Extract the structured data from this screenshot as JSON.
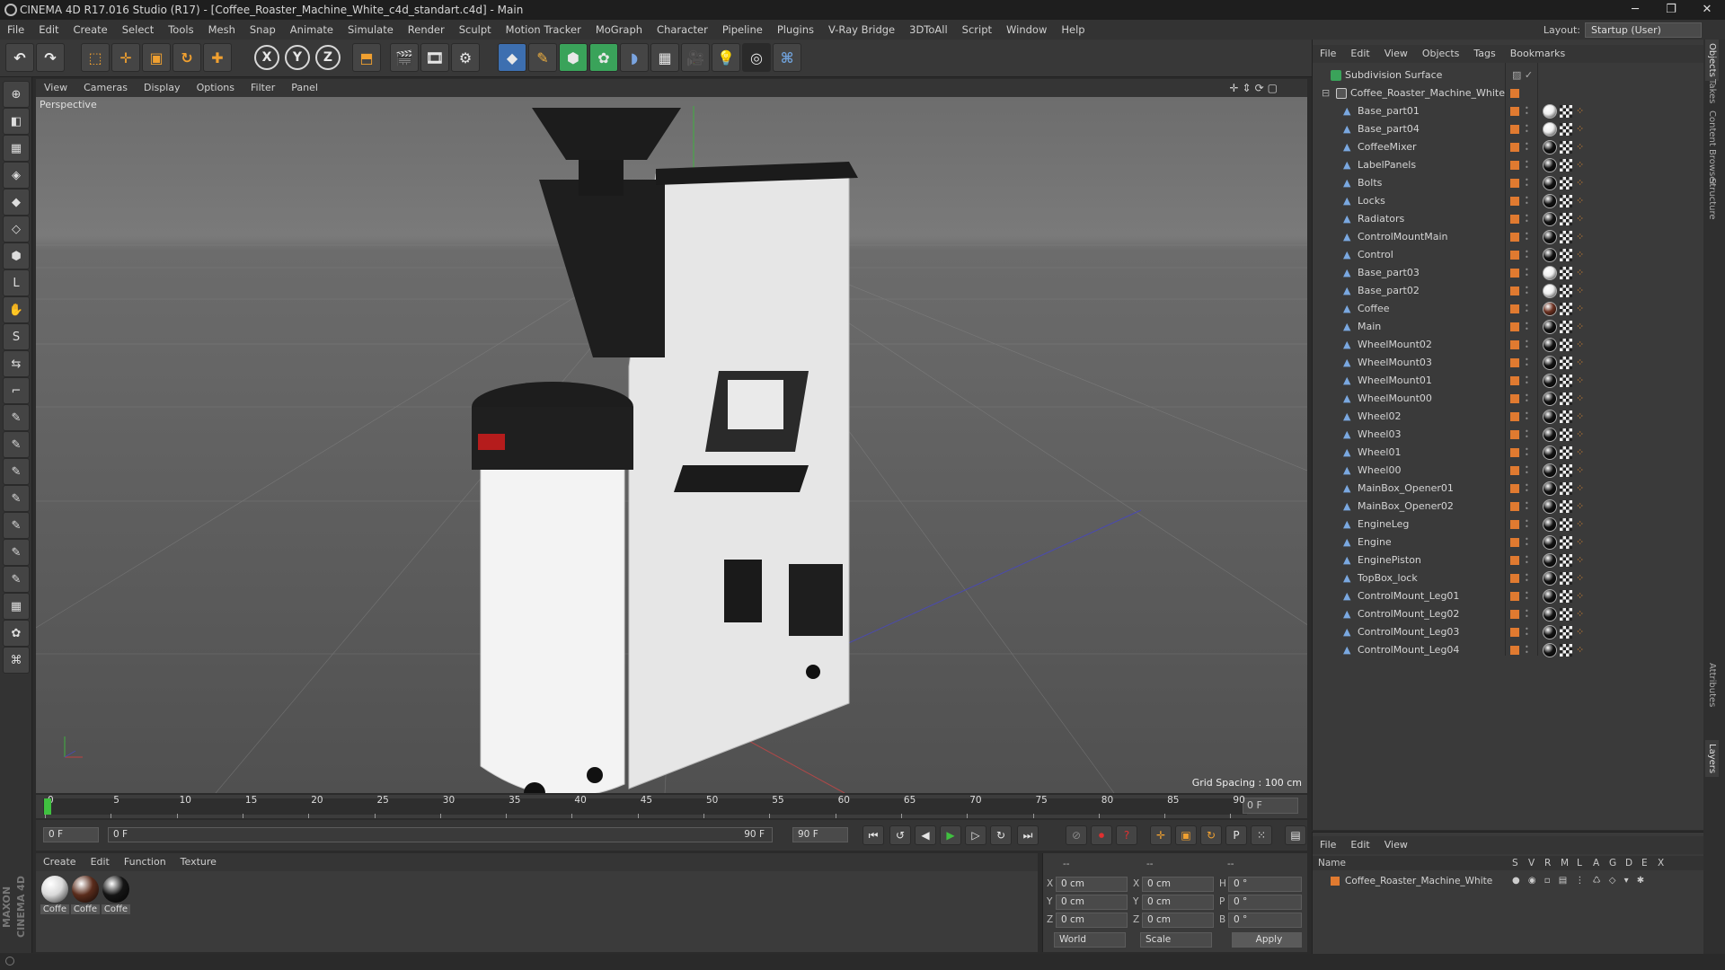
{
  "window": {
    "title": "CINEMA 4D R17.016 Studio (R17) - [Coffee_Roaster_Machine_White_c4d_standart.c4d] - Main"
  },
  "menu": [
    "File",
    "Edit",
    "Create",
    "Select",
    "Tools",
    "Mesh",
    "Snap",
    "Animate",
    "Simulate",
    "Render",
    "Sculpt",
    "Motion Tracker",
    "MoGraph",
    "Character",
    "Pipeline",
    "Plugins",
    "V-Ray Bridge",
    "3DToAll",
    "Script",
    "Window",
    "Help"
  ],
  "layout": {
    "label": "Layout:",
    "value": "Startup (User)"
  },
  "toolbar": {
    "x_label": "X",
    "y_label": "Y",
    "z_label": "Z"
  },
  "viewport": {
    "menu": [
      "View",
      "Cameras",
      "Display",
      "Options",
      "Filter",
      "Panel"
    ],
    "label": "Perspective",
    "grid_spacing": "Grid Spacing : 100 cm"
  },
  "timeline": {
    "ticks": [
      "0",
      "5",
      "10",
      "15",
      "20",
      "25",
      "30",
      "35",
      "40",
      "45",
      "50",
      "55",
      "60",
      "65",
      "70",
      "75",
      "80",
      "85",
      "90"
    ],
    "frame_end": "0 F"
  },
  "transport": {
    "start": "0 F",
    "range_start": "0 F",
    "range_end": "90 F",
    "end": "90 F"
  },
  "materials": {
    "menu": [
      "Create",
      "Edit",
      "Function",
      "Texture"
    ],
    "items": [
      {
        "name": "Coffe",
        "color": "#d9d9d9"
      },
      {
        "name": "Coffe",
        "color": "#5a2c1c"
      },
      {
        "name": "Coffe",
        "color": "#151515"
      }
    ]
  },
  "coords": {
    "header_left": "--",
    "header_mid": "--",
    "header_right": "--",
    "rows": [
      {
        "a": "X",
        "av": "0 cm",
        "b": "X",
        "bv": "0 cm",
        "c": "H",
        "cv": "0 °"
      },
      {
        "a": "Y",
        "av": "0 cm",
        "b": "Y",
        "bv": "0 cm",
        "c": "P",
        "cv": "0 °"
      },
      {
        "a": "Z",
        "av": "0 cm",
        "b": "Z",
        "bv": "0 cm",
        "c": "B",
        "cv": "0 °"
      }
    ],
    "mode1": "World",
    "mode2": "Scale",
    "apply": "Apply"
  },
  "objects": {
    "menu": [
      "File",
      "Edit",
      "View",
      "Objects",
      "Tags",
      "Bookmarks"
    ],
    "root": "Subdivision Surface",
    "group": "Coffee_Roaster_Machine_White",
    "items": [
      "Base_part01",
      "Base_part04",
      "CoffeeMixer",
      "LabelPanels",
      "Bolts",
      "Locks",
      "Radiators",
      "ControlMountMain",
      "Control",
      "Base_part03",
      "Base_part02",
      "Coffee",
      "Main",
      "WheelMount02",
      "WheelMount03",
      "WheelMount01",
      "WheelMount00",
      "Wheel02",
      "Wheel03",
      "Wheel01",
      "Wheel00",
      "MainBox_Opener01",
      "MainBox_Opener02",
      "EngineLeg",
      "Engine",
      "EnginePiston",
      "TopBox_lock",
      "ControlMount_Leg01",
      "ControlMount_Leg02",
      "ControlMount_Leg03",
      "ControlMount_Leg04"
    ]
  },
  "attributes": {
    "menu": [
      "File",
      "Edit",
      "View"
    ],
    "col_name": "Name",
    "cols": [
      "S",
      "V",
      "R",
      "M",
      "L",
      "A",
      "G",
      "D",
      "E",
      "X"
    ],
    "row": "Coffee_Roaster_Machine_White"
  },
  "right_tabs": [
    "Objects",
    "Takes",
    "Content Browser",
    "Structure",
    "Attributes",
    "Layers"
  ]
}
